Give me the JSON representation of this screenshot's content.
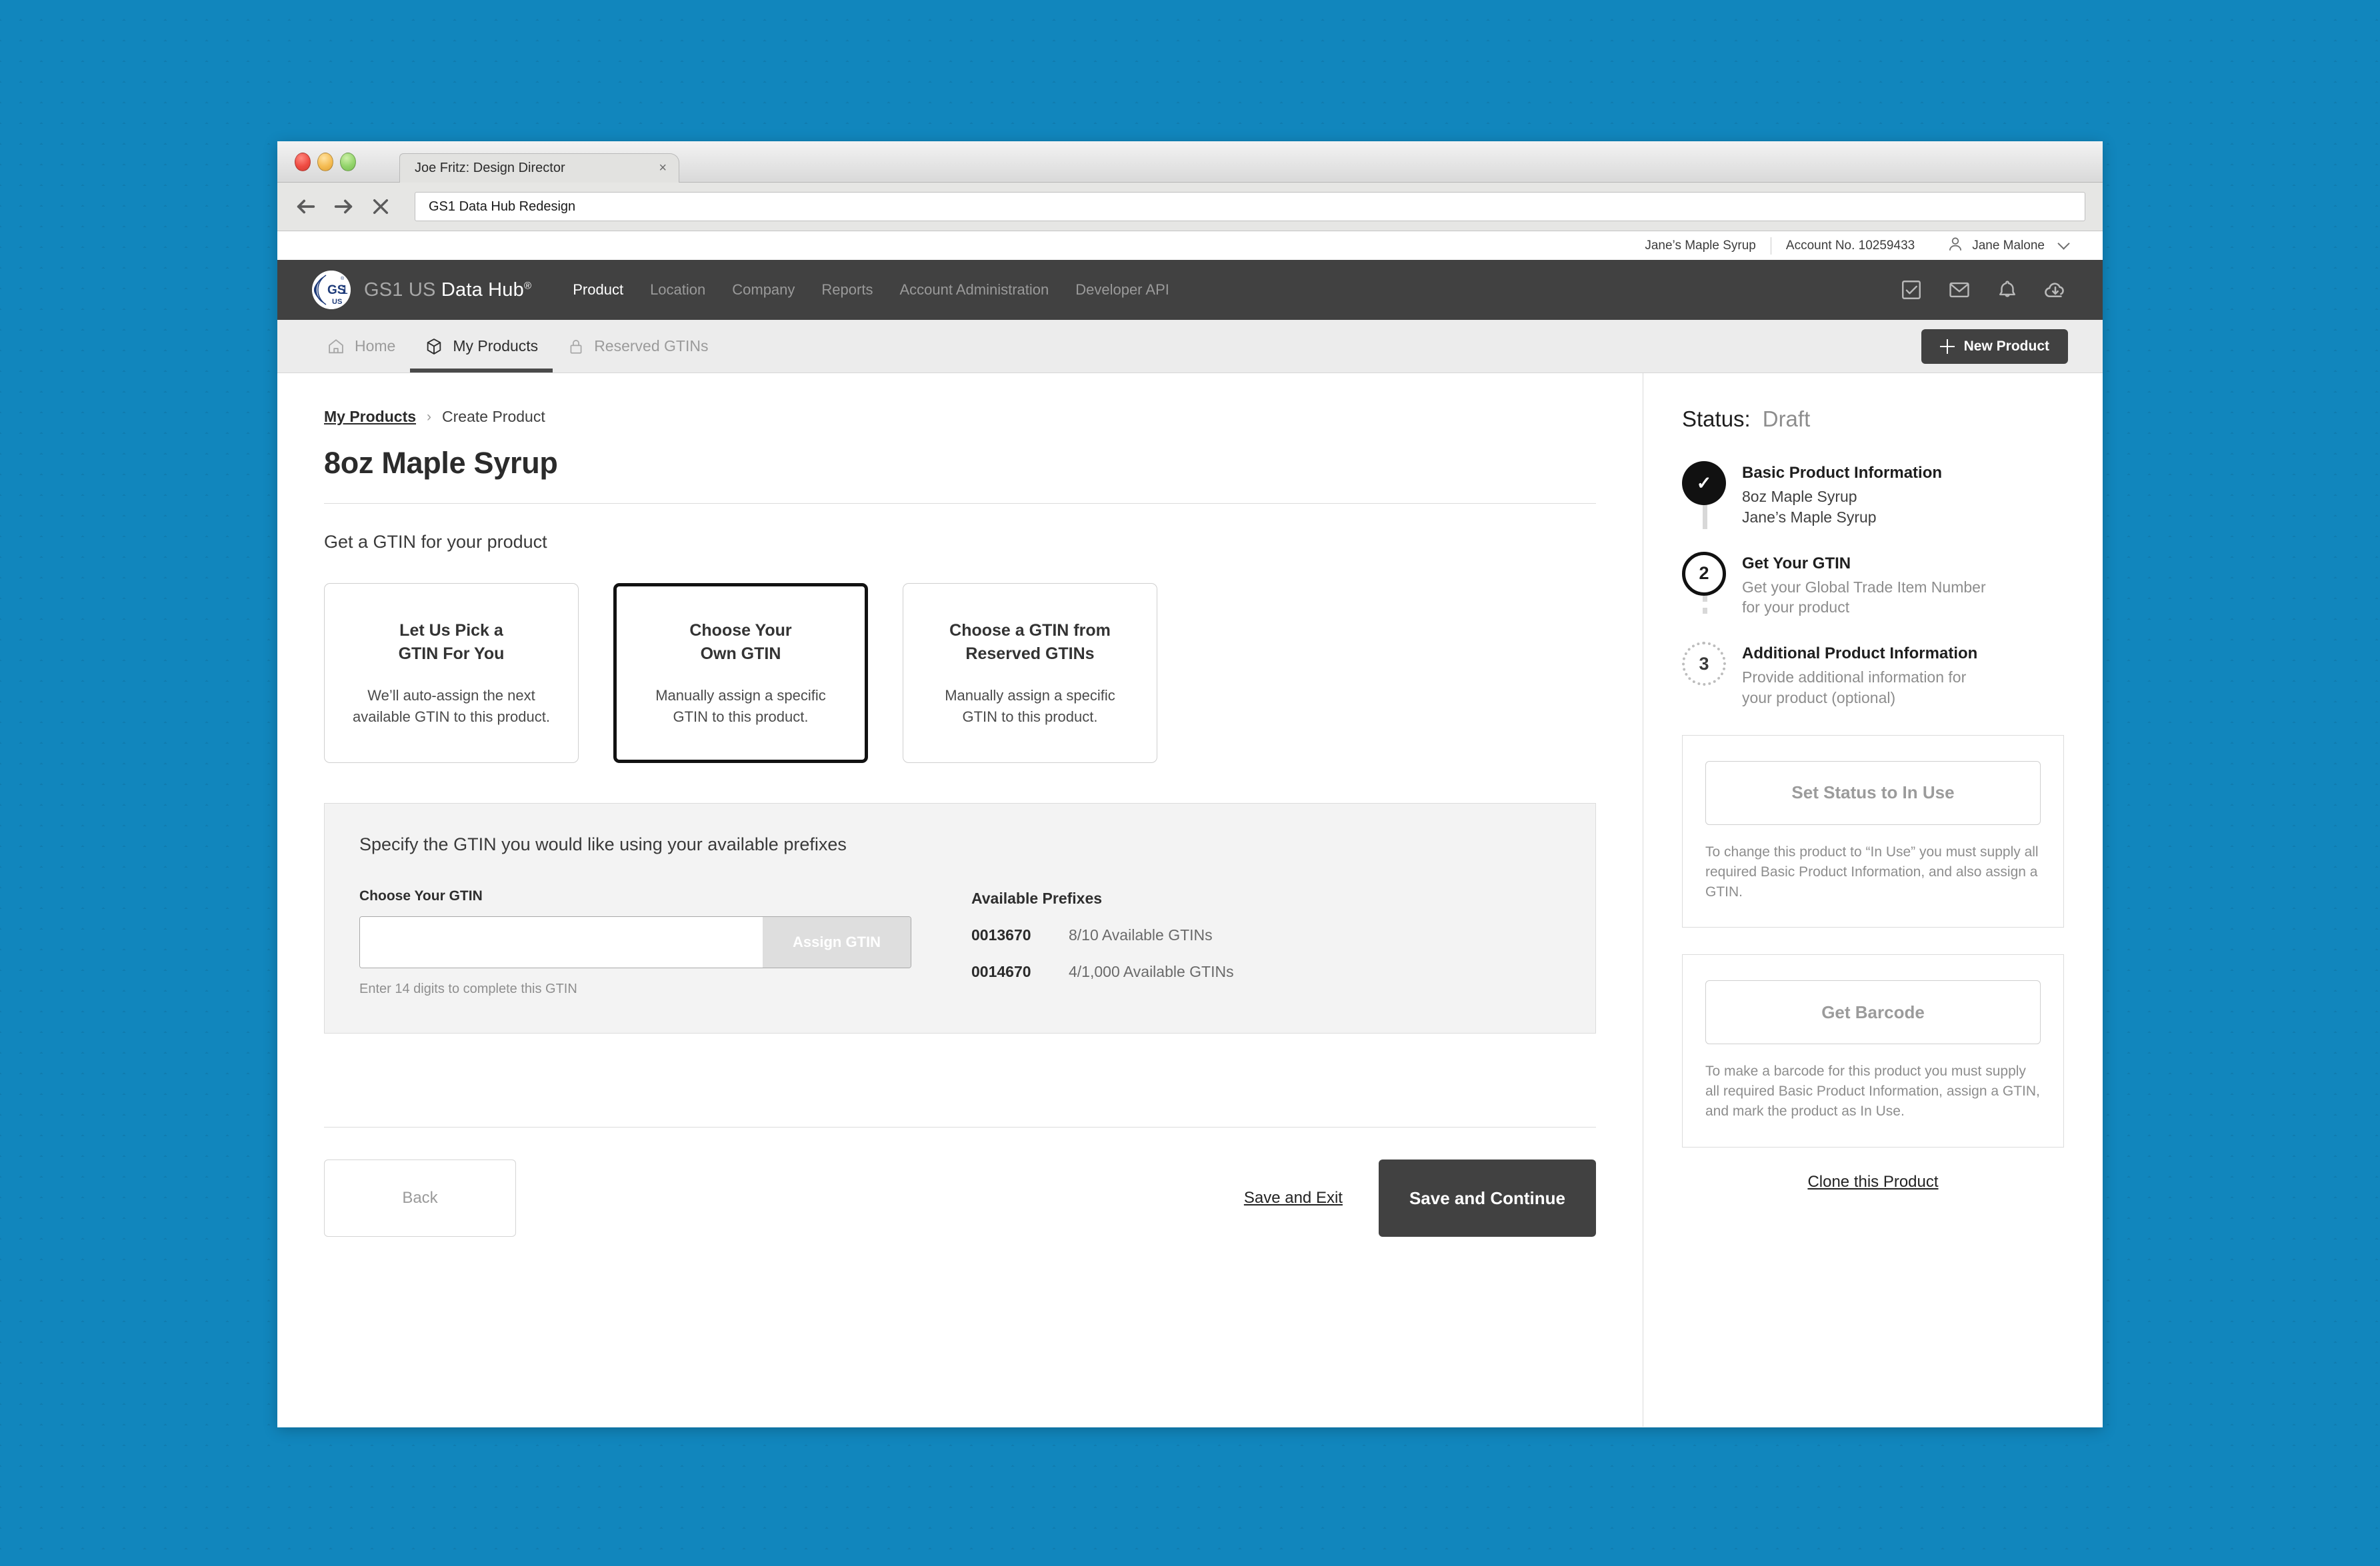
{
  "browser": {
    "tab_title": "Joe Fritz: Design Director",
    "tab_close": "×",
    "url_value": "GS1 Data Hub Redesign",
    "back_icon": "arrow-left-icon",
    "forward_icon": "arrow-right-icon",
    "stop_icon": "close-icon"
  },
  "account_bar": {
    "company": "Jane’s Maple Syrup",
    "account_no": "Account No. 10259433",
    "user_name": "Jane Malone"
  },
  "brand": {
    "logo_alt": "GS1 US",
    "logo_mark_text": "GS1",
    "logo_mark_sub": "US",
    "wordmark_dim": "GS1 US ",
    "wordmark_bright": "Data Hub",
    "registered": "®"
  },
  "main_nav": {
    "links": [
      {
        "label": "Product",
        "active": true
      },
      {
        "label": "Location",
        "active": false
      },
      {
        "label": "Company",
        "active": false
      },
      {
        "label": "Reports",
        "active": false
      },
      {
        "label": "Account Administration",
        "active": false
      },
      {
        "label": "Developer API",
        "active": false
      }
    ],
    "icons": [
      "checkbox-check-icon",
      "envelope-icon",
      "bell-icon",
      "cloud-download-icon"
    ]
  },
  "sub_nav": {
    "tabs": [
      {
        "label": "Home",
        "icon": "home-icon",
        "active": false
      },
      {
        "label": "My Products",
        "icon": "cube-icon",
        "active": true
      },
      {
        "label": "Reserved GTINs",
        "icon": "lock-icon",
        "active": false
      }
    ],
    "new_product_label": "New Product"
  },
  "breadcrumb": {
    "parent": "My Products",
    "separator": "›",
    "current": "Create Product"
  },
  "page": {
    "title": "8oz Maple Syrup",
    "section_heading": "Get a GTIN for your product"
  },
  "option_cards": [
    {
      "title_line1": "Let Us Pick a",
      "title_line2": "GTIN For You",
      "desc_line1": "We’ll auto-assign the next",
      "desc_line2": "available GTIN to this product.",
      "selected": false
    },
    {
      "title_line1": "Choose Your",
      "title_line2": "Own GTIN",
      "desc_line1": "Manually assign a specific",
      "desc_line2": "GTIN to this product.",
      "selected": true
    },
    {
      "title_line1": "Choose a GTIN from",
      "title_line2": "Reserved GTINs",
      "desc_line1": "Manually assign a specific",
      "desc_line2": "GTIN to this product.",
      "selected": false
    }
  ],
  "gtin_panel": {
    "heading": "Specify the GTIN you would like using your available prefixes",
    "field_label": "Choose Your GTIN",
    "input_value": "",
    "input_placeholder": "",
    "assign_button": "Assign GTIN",
    "hint": "Enter 14 digits to complete this GTIN",
    "prefixes_heading": "Available Prefixes",
    "prefixes": [
      {
        "code": "0013670",
        "available": "8/10 Available GTINs"
      },
      {
        "code": "0014670",
        "available": "4/1,000 Available GTINs"
      }
    ]
  },
  "footer": {
    "back_label": "Back",
    "save_exit_label": "Save and Exit",
    "save_continue_label": "Save and Continue"
  },
  "sidebar": {
    "status_label": "Status:",
    "status_value": "Draft",
    "steps": [
      {
        "marker": "✓",
        "state": "done",
        "title": "Basic Product Information",
        "sub_line1": "8oz Maple Syrup",
        "sub_line2": "Jane’s Maple Syrup",
        "muted": false
      },
      {
        "marker": "2",
        "state": "current",
        "title": "Get Your GTIN",
        "sub_line1": "Get your Global Trade Item Number",
        "sub_line2": "for your product",
        "muted": true
      },
      {
        "marker": "3",
        "state": "future",
        "title": "Additional Product Information",
        "sub_line1": "Provide additional information for",
        "sub_line2": "your product (optional)",
        "muted": true
      }
    ],
    "cards": [
      {
        "button": "Set Status to In Use",
        "note": "To change this product to “In Use” you must supply all required Basic Product Information, and also assign a GTIN."
      },
      {
        "button": "Get Barcode",
        "note": "To make a barcode for this product you must supply all required Basic Product Information, assign a GTIN, and mark the product as In Use."
      }
    ],
    "clone_link": "Clone this Product"
  },
  "colors": {
    "page_background": "#1186bd",
    "nav_dark": "#414141",
    "accent_dark": "#111111",
    "panel_gray": "#f3f3f3",
    "brand_blue": "#1f3c7a"
  }
}
